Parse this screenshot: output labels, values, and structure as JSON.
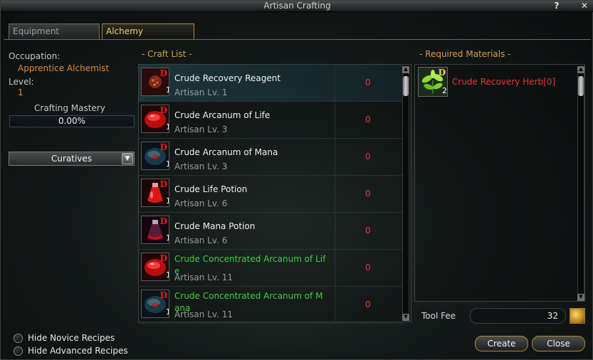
{
  "window": {
    "title": "Artisan Crafting",
    "help_label": "?",
    "close_label": "✕"
  },
  "tabs": [
    {
      "label": "Equipment"
    },
    {
      "label": "Alchemy"
    }
  ],
  "info": {
    "occupation_label": "Occupation:",
    "occupation_value": "Apprentice Alchemist",
    "level_label": "Level:",
    "level_value": "1",
    "mastery_label": "Crafting Mastery",
    "mastery_value": "0.00%",
    "mastery_fraction": 0.0
  },
  "category_dropdown": {
    "selected": "Curatives"
  },
  "craft_list": {
    "header": "- Craft List -",
    "items": [
      {
        "name": "Crude Recovery Reagent",
        "level": "Artisan Lv. 1",
        "count": "0",
        "grade": "D",
        "qty": "1",
        "icon": "reagent-icon",
        "color": "#f0f0f0",
        "selected": true
      },
      {
        "name": "Crude Arcanum of Life",
        "level": "Artisan Lv. 3",
        "count": "0",
        "grade": "D",
        "qty": "1",
        "icon": "red-arcanum-icon",
        "color": "#f0f0f0"
      },
      {
        "name": "Crude Arcanum of Mana",
        "level": "Artisan Lv. 3",
        "count": "0",
        "grade": "D",
        "qty": "1",
        "icon": "blue-arcanum-icon",
        "color": "#f0f0f0"
      },
      {
        "name": "Crude Life Potion",
        "level": "Artisan Lv. 6",
        "count": "0",
        "grade": "D",
        "qty": "1",
        "icon": "red-potion-icon",
        "color": "#f0f0f0"
      },
      {
        "name": "Crude Mana Potion",
        "level": "Artisan Lv. 6",
        "count": "0",
        "grade": "D",
        "qty": "1",
        "icon": "mana-potion-icon",
        "color": "#f0f0f0"
      },
      {
        "name": "Crude Concentrated Arcanum of Lif e",
        "level": "Artisan Lv. 11",
        "count": "0",
        "grade": "D",
        "qty": "1",
        "icon": "red-arcanum-icon",
        "color": "#3ed03e"
      },
      {
        "name": "Crude Concentrated Arcanum of M ana",
        "level": "Artisan Lv. 11",
        "count": "0",
        "grade": "D",
        "qty": "1",
        "icon": "blue-arcanum-icon",
        "color": "#3ed03e"
      }
    ]
  },
  "required_materials": {
    "header": "- Required Materials -",
    "items": [
      {
        "name": "Crude Recovery Herb[0]",
        "grade": "D",
        "qty": "2",
        "icon": "herb-icon",
        "color": "#e23838"
      }
    ]
  },
  "tool_fee": {
    "label": "Tool Fee",
    "value": "32",
    "icon": "gold-coin-icon"
  },
  "options": [
    {
      "label": "Hide Novice Recipes"
    },
    {
      "label": "Hide Advanced Recipes"
    }
  ],
  "buttons": {
    "create": "Create",
    "close": "Close"
  }
}
